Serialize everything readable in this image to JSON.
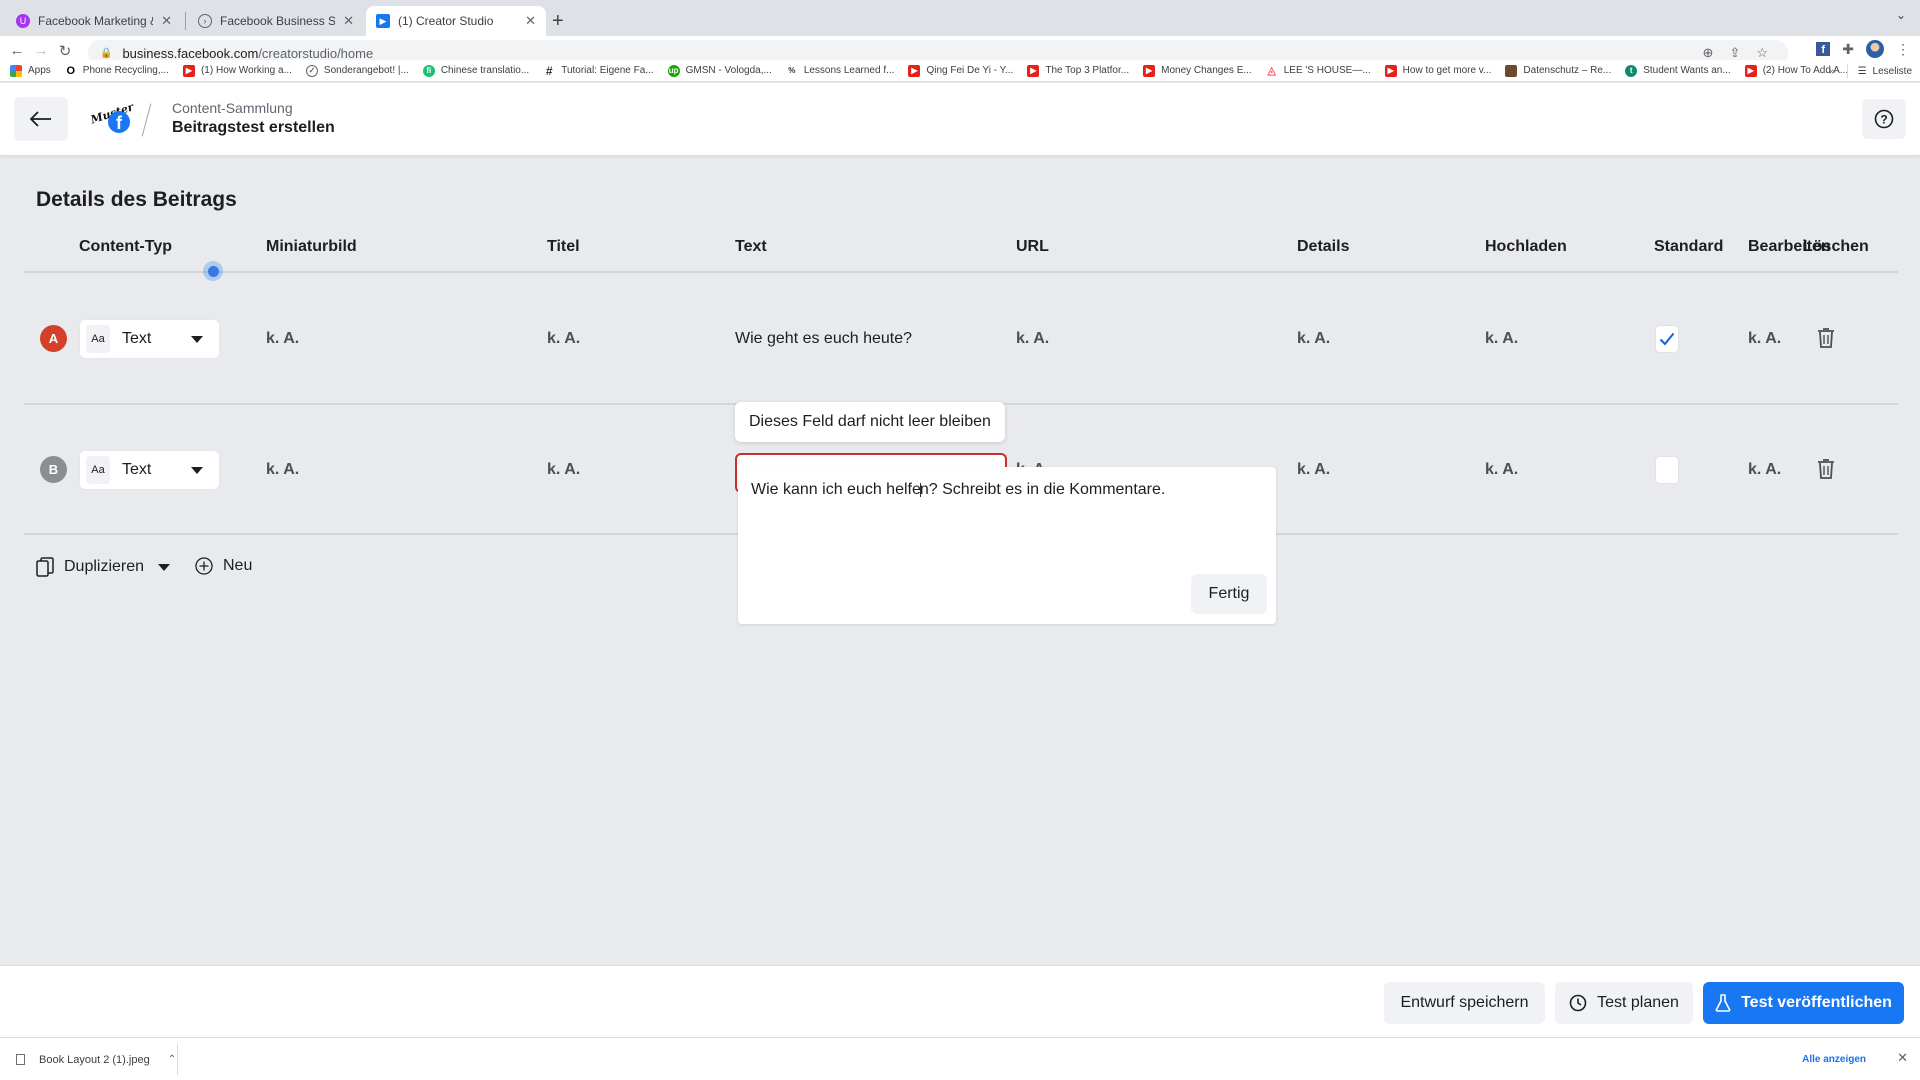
{
  "browser": {
    "tabs": [
      {
        "title": "Facebook Marketing & Werbea",
        "icon": "udemy-icon",
        "active": false
      },
      {
        "title": "Facebook Business Suite",
        "icon": "business-suite-icon",
        "active": false
      },
      {
        "title": "(1) Creator Studio",
        "icon": "creator-studio-icon",
        "active": true
      }
    ],
    "new_tab": "+",
    "url_host": "business.facebook.com",
    "url_path": "/creatorstudio/home",
    "bookmarks": [
      {
        "label": "Apps",
        "icon": "apps-grid-icon"
      },
      {
        "label": "Phone Recycling,...",
        "icon": "o2-icon"
      },
      {
        "label": "(1) How Working a...",
        "icon": "youtube-icon"
      },
      {
        "label": "Sonderangebot! |...",
        "icon": "check-badge-icon"
      },
      {
        "label": "Chinese translatio...",
        "icon": "fiverr-icon"
      },
      {
        "label": "Tutorial: Eigene Fa...",
        "icon": "hashtag-icon"
      },
      {
        "label": "GMSN - Vologda,...",
        "icon": "upwork-icon"
      },
      {
        "label": "Lessons Learned f...",
        "icon": "percent-icon"
      },
      {
        "label": "Qing Fei De Yi - Y...",
        "icon": "youtube-icon"
      },
      {
        "label": "The Top 3 Platfor...",
        "icon": "youtube-icon"
      },
      {
        "label": "Money Changes E...",
        "icon": "youtube-icon"
      },
      {
        "label": "LEE 'S HOUSE—...",
        "icon": "airbnb-icon"
      },
      {
        "label": "How to get more v...",
        "icon": "youtube-icon"
      },
      {
        "label": "Datenschutz – Re...",
        "icon": "image-thumb-icon"
      },
      {
        "label": "Student Wants an...",
        "icon": "t-circle-icon"
      },
      {
        "label": "(2) How To Add A...",
        "icon": "youtube-icon"
      }
    ],
    "bookmarks_more": "»",
    "reading_list": "Leseliste"
  },
  "header": {
    "breadcrumb": "Content-Sammlung",
    "title": "Beitragstest erstellen",
    "logo_text": "Muster"
  },
  "main": {
    "section_title": "Details des Beitrags",
    "columns": [
      "Content-Typ",
      "Miniaturbild",
      "Titel",
      "Text",
      "URL",
      "Details",
      "Hochladen",
      "Standard",
      "Bearbeiten",
      "Löschen"
    ],
    "rows": [
      {
        "badge": "A",
        "badge_color": "#d5402b",
        "content_type": "Text",
        "type_icon": "Aa",
        "thumbnail": "k. A.",
        "title": "k. A.",
        "text": "Wie geht es euch heute?",
        "url": "k. A.",
        "details": "k. A.",
        "upload": "k. A.",
        "standard_checked": true,
        "edit": "k. A."
      },
      {
        "badge": "B",
        "badge_color": "#8a8d91",
        "content_type": "Text",
        "type_icon": "Aa",
        "thumbnail": "k. A.",
        "title": "k. A.",
        "text": "",
        "url": "k. A.",
        "details": "k. A.",
        "upload": "k. A.",
        "standard_checked": false,
        "edit": "k. A."
      }
    ],
    "validation_tooltip": "Dieses Feld darf nicht leer bleiben",
    "editor": {
      "value_before_cursor": "Wie kann ich euch helfe",
      "value_after_cursor": "n? Schreibt es in die Kommentare.",
      "done_label": "Fertig"
    },
    "duplicate_label": "Duplizieren",
    "new_label": "Neu"
  },
  "footer": {
    "save_draft": "Entwurf speichern",
    "schedule_test": "Test planen",
    "publish_test": "Test veröffentlichen",
    "accent_color": "#1877f2"
  },
  "downloads": {
    "file_name": "Book Layout 2 (1).jpeg",
    "show_all": "Alle anzeigen"
  }
}
